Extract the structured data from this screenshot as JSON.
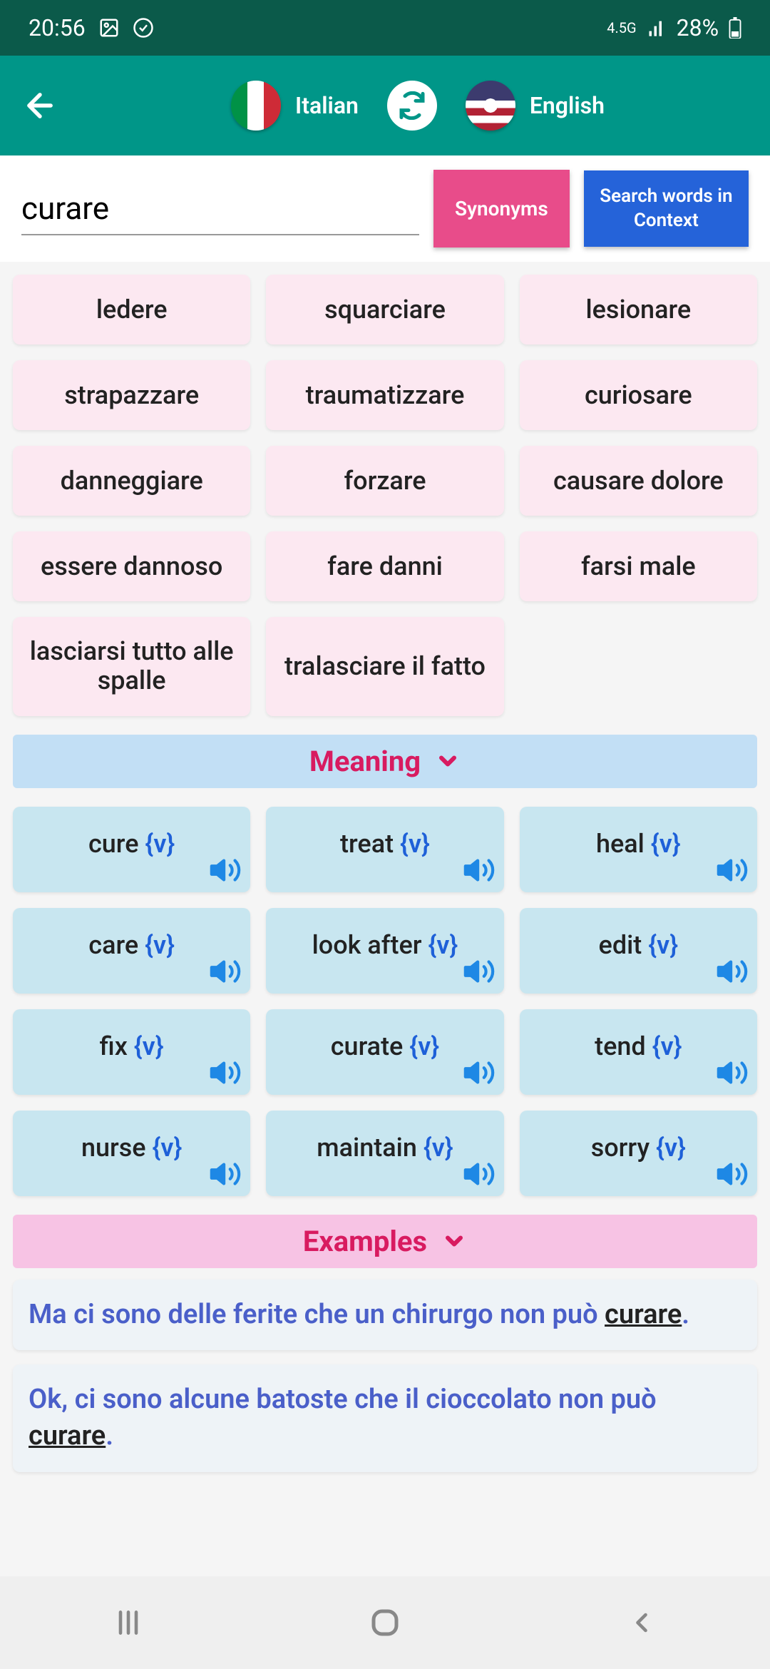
{
  "status": {
    "time": "20:56",
    "network": "4.5G",
    "battery": "28%"
  },
  "header": {
    "lang_from": "Italian",
    "lang_to": "English"
  },
  "search": {
    "value": "curare",
    "synonyms_btn": "Synonyms",
    "context_btn": "Search words in Context"
  },
  "synonyms": [
    "ledere",
    "squarciare",
    "lesionare",
    "strapazzare",
    "traumatizzare",
    "curiosare",
    "danneggiare",
    "forzare",
    "causare dolore",
    "essere dannoso",
    "fare danni",
    "farsi male",
    "lasciarsi tutto alle spalle",
    "tralasciare il fatto"
  ],
  "sections": {
    "meaning": "Meaning",
    "examples": "Examples"
  },
  "meanings": [
    {
      "word": "cure",
      "tag": "{v}"
    },
    {
      "word": "treat",
      "tag": "{v}"
    },
    {
      "word": "heal",
      "tag": "{v}"
    },
    {
      "word": "care",
      "tag": "{v}"
    },
    {
      "word": "look after",
      "tag": "{v}"
    },
    {
      "word": "edit",
      "tag": "{v}"
    },
    {
      "word": "fix",
      "tag": "{v}"
    },
    {
      "word": "curate",
      "tag": "{v}"
    },
    {
      "word": "tend",
      "tag": "{v}"
    },
    {
      "word": "nurse",
      "tag": "{v}"
    },
    {
      "word": "maintain",
      "tag": "{v}"
    },
    {
      "word": "sorry",
      "tag": "{v}"
    }
  ],
  "examples": [
    {
      "pre": "Ma ci sono delle ferite che un chirurgo non può ",
      "hl": "curare",
      "post": "."
    },
    {
      "pre": "Ok, ci sono alcune batoste che il cioccolato non può ",
      "hl": "curare",
      "post": "."
    }
  ]
}
